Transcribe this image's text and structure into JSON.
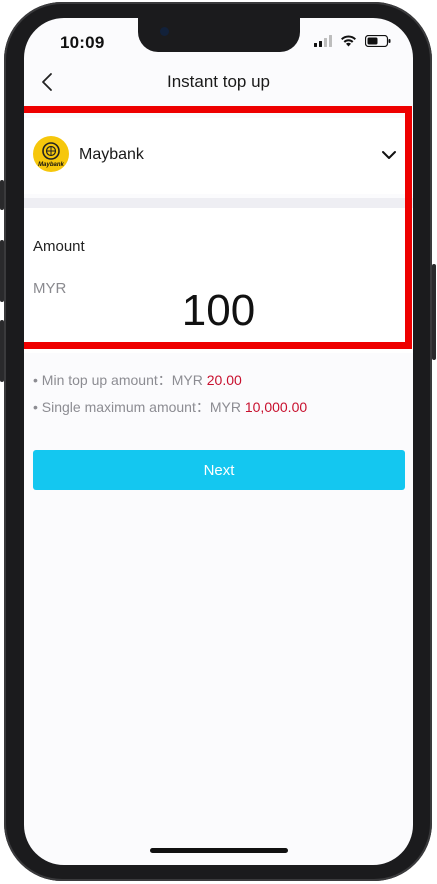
{
  "status": {
    "time": "10:09"
  },
  "nav": {
    "title": "Instant top up"
  },
  "bank": {
    "name": "Maybank",
    "logo_text": "Maybank"
  },
  "amount": {
    "label": "Amount",
    "currency": "MYR",
    "value": "100"
  },
  "info": {
    "min_label": "• Min top up amount：MYR ",
    "min_value": "20.00",
    "max_label": "• Single maximum amount：MYR ",
    "max_value": "10,000.00"
  },
  "actions": {
    "next_label": "Next"
  },
  "colors": {
    "accent": "#14c7f0",
    "highlight": "#ee0000",
    "limit_value": "#c8102e",
    "bank_brand": "#f6c70c"
  },
  "icons": [
    "back-chevron-icon",
    "chevron-down-icon",
    "signal-icon",
    "wifi-icon",
    "battery-icon",
    "maybank-logo-icon"
  ]
}
